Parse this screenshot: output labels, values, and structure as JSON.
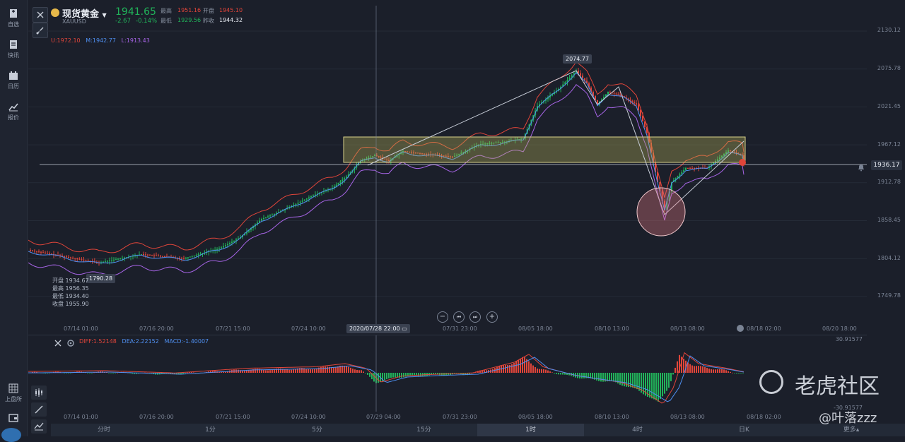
{
  "sidebar": {
    "items": [
      {
        "label": "自选",
        "icon": "bookmark-icon"
      },
      {
        "label": "快讯",
        "icon": "news-icon"
      },
      {
        "label": "日历",
        "icon": "calendar-icon"
      },
      {
        "label": "报价",
        "icon": "trend-icon"
      }
    ],
    "bottom": [
      {
        "label": "上盘所",
        "icon": "grid-icon"
      }
    ]
  },
  "header": {
    "title": "现货黄金",
    "symbol": "XAUUSD",
    "price": "1941.65",
    "change": "-2.67",
    "change_pct": "-0.14%",
    "high_label": "最高",
    "high": "1951.16",
    "open_label": "开盘",
    "open": "1945.10",
    "low_label": "最低",
    "low": "1929.56",
    "prev_close_label": "昨收",
    "prev_close": "1944.32",
    "colors": {
      "up": "#21b35a",
      "down": "#e0453a",
      "neutral": "#e8ecf3"
    }
  },
  "bands": {
    "upper": "U:1972.10",
    "middle": "M:1942.77",
    "lower": "L:1913.43"
  },
  "chart": {
    "y_ticks": [
      "2130.12",
      "2075.78",
      "2021.45",
      "1967.12",
      "1912.78",
      "1858.45",
      "1804.12",
      "1749.78"
    ],
    "x_ticks": [
      "07/14 01:00",
      "07/16 20:00",
      "07/21 15:00",
      "07/24 10:00",
      "07/31 23:00",
      "08/05 18:00",
      "08/10 13:00",
      "08/13 08:00",
      "08/18 02:00",
      "08/20 18:00"
    ],
    "crosshair_label": "2020/07/28 22:00",
    "peak_label": "2074.77",
    "low_label": "1790.28",
    "current_price": "1936.17",
    "ohlc_popup": {
      "open": "开盘 1934.67",
      "high": "最高 1956.35",
      "low": "最低 1934.40",
      "close": "收盘 1955.90"
    }
  },
  "macd": {
    "diff": "DIFF:1.52148",
    "dea": "DEA:2.22152",
    "macd": "MACD:-1.40007",
    "y_top": "30.91577",
    "y_bottom": "-30.91577",
    "x_ticks": [
      "07/14 01:00",
      "07/16 20:00",
      "07/21 15:00",
      "07/24 10:00",
      "07/29 04:00",
      "07/31 23:00",
      "08/05 18:00",
      "08/10 13:00",
      "08/13 08:00",
      "08/18 02:00"
    ]
  },
  "tabs": [
    {
      "label": "分时"
    },
    {
      "label": "1分"
    },
    {
      "label": "5分"
    },
    {
      "label": "15分"
    },
    {
      "label": "1时",
      "active": true
    },
    {
      "label": "4时"
    },
    {
      "label": "日K"
    },
    {
      "label": "更多▴"
    }
  ],
  "watermark": {
    "brand": "老虎社区",
    "user": "@叶落zzz"
  }
}
